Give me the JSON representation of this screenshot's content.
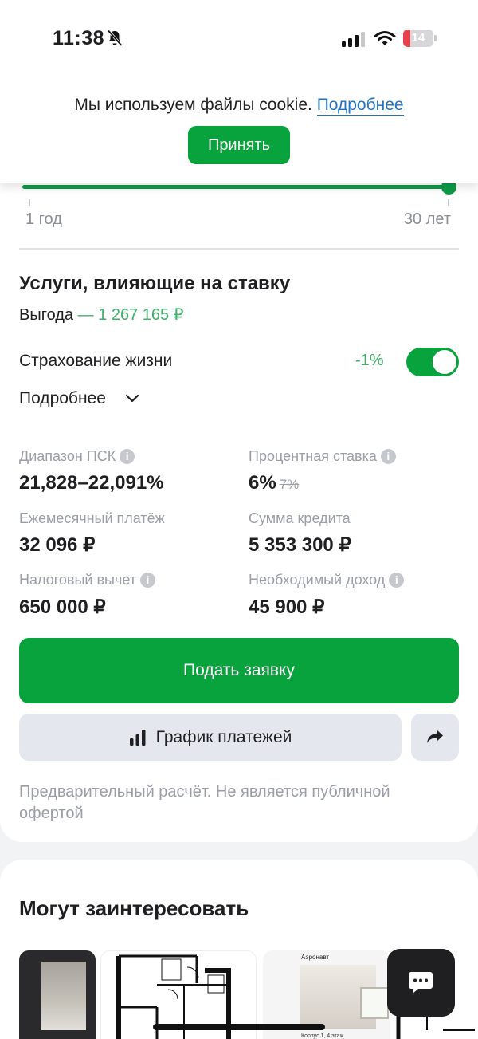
{
  "status_bar": {
    "time": "11:38",
    "battery_level": "14",
    "battery_color": "#e8414a"
  },
  "cookie_banner": {
    "text": "Мы используем файлы cookie.",
    "link_label": "Подробнее",
    "accept_label": "Принять"
  },
  "term_slider": {
    "min_label": "1 год",
    "max_label": "30 лет",
    "value_fraction": 1.0
  },
  "services": {
    "title": "Услуги, влияющие на ставку",
    "benefit_label": "Выгода",
    "benefit_value": "— 1 267 165 ₽",
    "life_insurance_label": "Страхование жизни",
    "life_insurance_discount": "-1%",
    "life_insurance_enabled": true,
    "more_label": "Подробнее"
  },
  "stats": {
    "psk_label": "Диапазон ПСК",
    "psk_value": "21,828–22,091%",
    "rate_label": "Процентная ставка",
    "rate_value": "6%",
    "rate_old": "7%",
    "payment_label": "Ежемесячный платёж",
    "payment_value": "32 096 ₽",
    "credit_label": "Сумма кредита",
    "credit_value": "5 353 300 ₽",
    "tax_label": "Налоговый вычет",
    "tax_value": "650 000 ₽",
    "income_label": "Необходимый доход",
    "income_value": "45 900 ₽"
  },
  "actions": {
    "apply_label": "Подать заявку",
    "schedule_label": "График платежей"
  },
  "disclaimer": "Предварительный расчёт. Не является публичной офертой",
  "recommendations": {
    "title": "Могут заинтересовать",
    "card3_caption": "Аэронавт",
    "card3_subtitle": "Корпус 1, 4 этаж"
  },
  "colors": {
    "brand_green": "#08a33c",
    "benefit_green": "#3db36a",
    "link_blue": "#2173c4"
  }
}
